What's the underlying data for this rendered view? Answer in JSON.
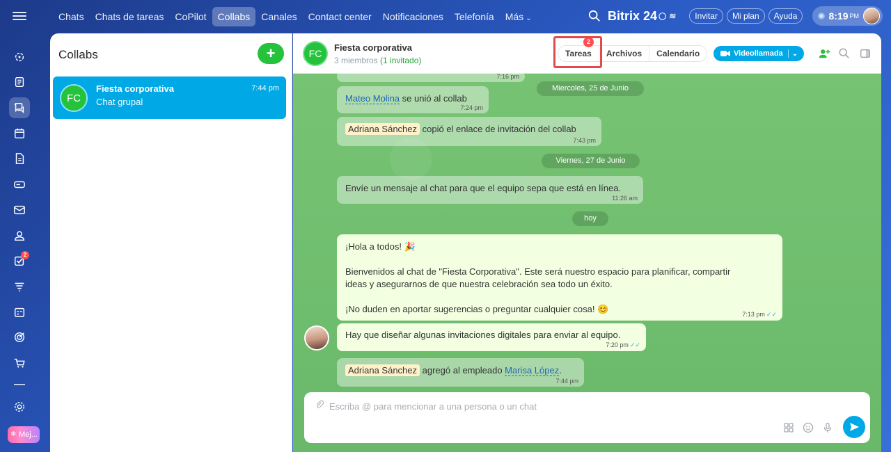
{
  "nav": {
    "items": [
      "Chats",
      "Chats de tareas",
      "CoPilot",
      "Collabs",
      "Canales",
      "Contact center",
      "Notificaciones",
      "Telefonía"
    ],
    "more_label": "Más",
    "active_index": 3
  },
  "brand": {
    "name": "Bitrix 24"
  },
  "top_buttons": {
    "invite": "Invitar",
    "plan": "Mi plan",
    "help": "Ayuda"
  },
  "clock": {
    "time": "8:19",
    "ampm": "PM"
  },
  "rail": {
    "tasks_badge": "2",
    "mej_label": "Mej..."
  },
  "left_panel": {
    "title": "Collabs",
    "chat": {
      "initials": "FC",
      "name": "Fiesta corporativa",
      "subtitle": "Chat grupal",
      "time": "7:44 pm"
    }
  },
  "header": {
    "initials": "FC",
    "title": "Fiesta corporativa",
    "members": "3 miembros",
    "invited": "(1 invitado)",
    "tabs": [
      "Tareas",
      "Archivos",
      "Calendario"
    ],
    "tasks_badge": "2",
    "video_label": "Videollamada"
  },
  "messages": {
    "m0_time": "7:16 pm",
    "date1": "Miercoles, 25 de Junio",
    "m1": {
      "name": "Mateo Molina",
      "text": " se unió al collab",
      "time": "7:24 pm"
    },
    "m2": {
      "name": "Adriana Sánchez",
      "text": " copió el enlace de invitación del collab",
      "time": "7:43 pm"
    },
    "date2": "Viernes, 27 de Junio",
    "m3": {
      "text": "Envíe un mensaje al chat para que el equipo sepa que está en línea.",
      "time": "11:26 am"
    },
    "date3": "hoy",
    "m4": {
      "line1": "¡Hola a todos! 🎉",
      "line2": "Bienvenidos al chat de \"Fiesta Corporativa\". Este será nuestro espacio para planificar, compartir",
      "line3": "ideas y asegurarnos de que nuestra celebración sea todo un éxito.",
      "line4": "¡No duden en aportar sugerencias o preguntar cualquier cosa! 😊",
      "time": "7:13 pm"
    },
    "m5": {
      "text": "Hay que diseñar algunas invitaciones digitales para enviar al equipo.",
      "time": "7:20 pm"
    },
    "m6": {
      "name": "Adriana Sánchez",
      "text": " agregó al empleado ",
      "target": "Marisa López",
      "suffix": ".",
      "time": "7:44 pm"
    }
  },
  "composer": {
    "placeholder": "Escriba @ para mencionar a una persona o un chat"
  },
  "colors": {
    "accent": "#00a9e5",
    "green": "#25c23c",
    "badge": "#ff4d4d",
    "highlight": "#e04b4b",
    "chat_bg": "#6dbf6b"
  }
}
